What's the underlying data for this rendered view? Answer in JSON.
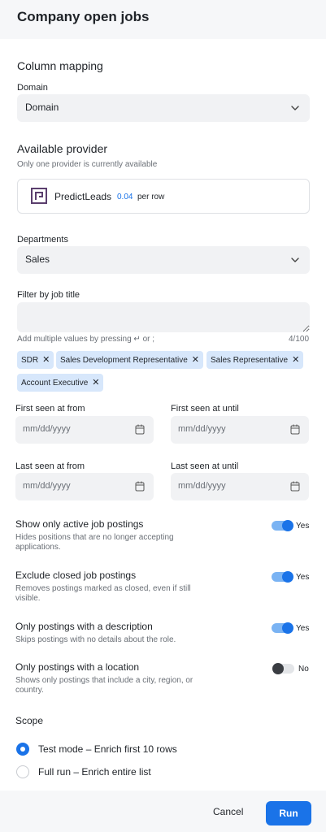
{
  "header": {
    "title": "Company open jobs"
  },
  "column_mapping": {
    "title": "Column mapping",
    "domain_label": "Domain",
    "domain_value": "Domain"
  },
  "provider": {
    "title": "Available provider",
    "subtitle": "Only one provider is currently available",
    "name": "PredictLeads",
    "price": "0.04",
    "price_unit": "per row",
    "logo_color": "#5b3f6e"
  },
  "departments": {
    "label": "Departments",
    "value": "Sales"
  },
  "job_title_filter": {
    "label": "Filter by job title",
    "hint": "Add multiple values by pressing ↵ or ;",
    "count": "4/100",
    "chips": [
      "SDR",
      "Sales Development Representative",
      "Sales Representative",
      "Account Executive"
    ]
  },
  "dates": {
    "first_from_label": "First seen at from",
    "first_until_label": "First seen at until",
    "last_from_label": "Last seen at from",
    "last_until_label": "Last seen at until",
    "placeholder": "mm/dd/yyyy"
  },
  "options": [
    {
      "title": "Show only active job postings",
      "desc": "Hides positions that are no longer accepting applications.",
      "state": "Yes",
      "on": true
    },
    {
      "title": "Exclude closed job postings",
      "desc": "Removes postings marked as closed, even if still visible.",
      "state": "Yes",
      "on": true
    },
    {
      "title": "Only postings with a description",
      "desc": "Skips postings with no details about the role.",
      "state": "Yes",
      "on": true
    },
    {
      "title": "Only postings with a location",
      "desc": "Shows only postings that include a city, region, or country.",
      "state": "No",
      "on": false
    }
  ],
  "scope": {
    "title": "Scope",
    "test_mode": "Test mode – Enrich first 10 rows",
    "full_run": "Full run – Enrich entire list",
    "selected": "test_mode"
  },
  "footer": {
    "cancel": "Cancel",
    "run": "Run"
  },
  "colors": {
    "accent": "#1a73e8",
    "chip_bg": "#d7e7fb",
    "field_bg": "#f1f2f4"
  }
}
